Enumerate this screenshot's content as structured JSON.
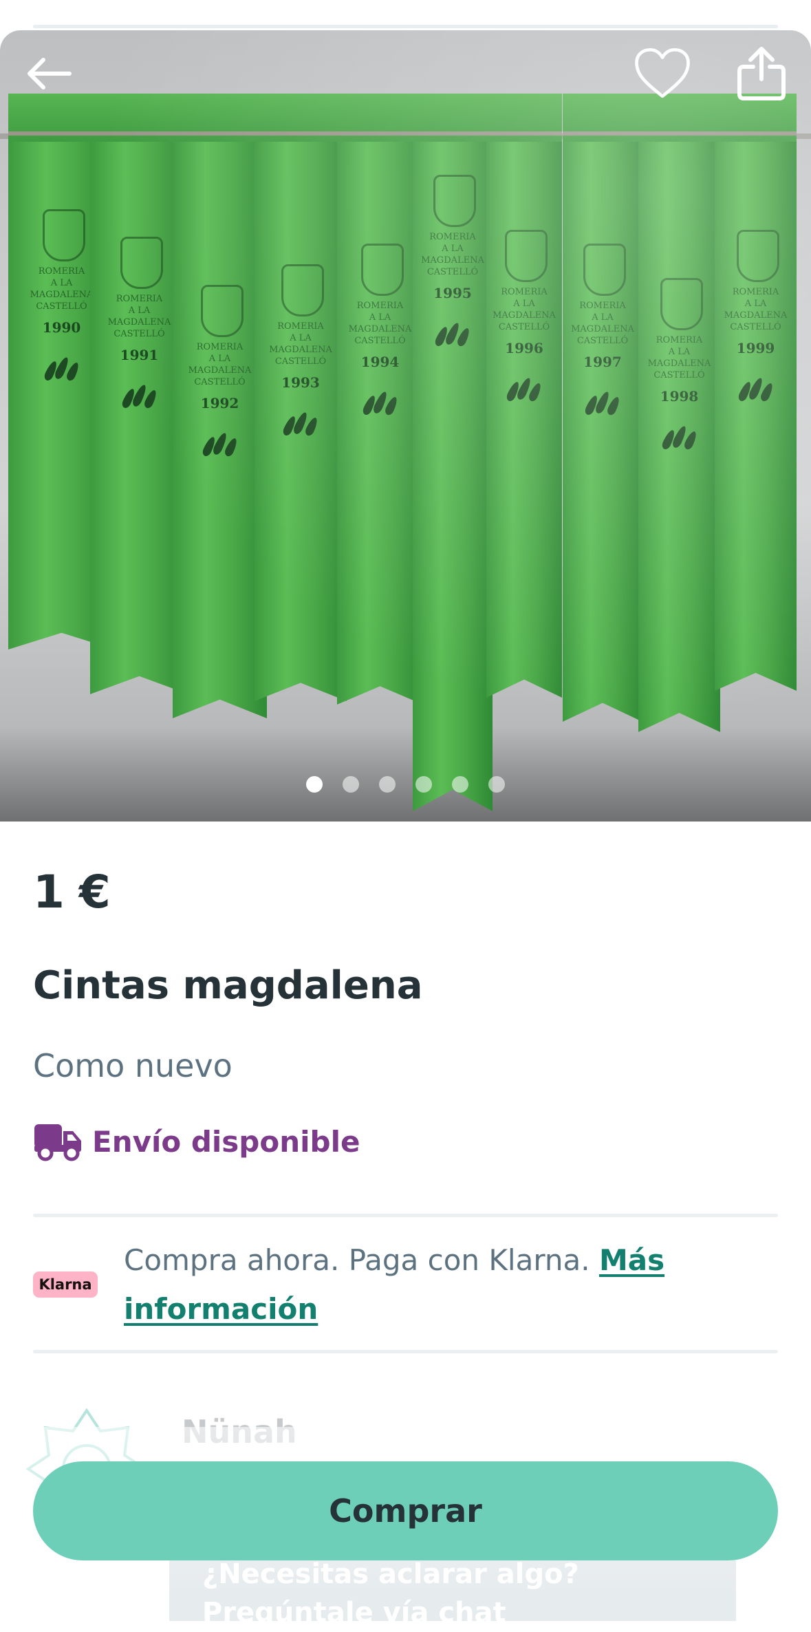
{
  "gallery": {
    "total_images": 6,
    "active_index": 0,
    "ribbon_years": [
      "1990",
      "1991",
      "1992",
      "1993",
      "1994",
      "1995",
      "1996",
      "1997",
      "1998",
      "1999"
    ],
    "ribbon_line1": "ROMERIA",
    "ribbon_line2": "A LA",
    "ribbon_line3": "MAGDALENA",
    "ribbon_line4": "CASTELLÓ",
    "ribbon_color": "#4aa847"
  },
  "actions": {
    "back_icon": "arrow-left-icon",
    "favorite_icon": "heart-icon",
    "share_icon": "share-icon"
  },
  "item": {
    "price": "1 €",
    "title": "Cintas magdalena",
    "condition": "Como nuevo",
    "shipping_label": "Envío disponible",
    "shipping_icon": "truck-icon",
    "shipping_color": "#7c3a8a"
  },
  "klarna": {
    "badge": "Klarna",
    "text": "Compra ahora. Paga con Klarna.",
    "link": "Más información"
  },
  "seller": {
    "name": "Nünah"
  },
  "chat_hint": {
    "text": "¿Necesitas aclarar algo? Pregúntale vía chat"
  },
  "buy": {
    "label": "Comprar",
    "color": "#6ecfb9"
  }
}
